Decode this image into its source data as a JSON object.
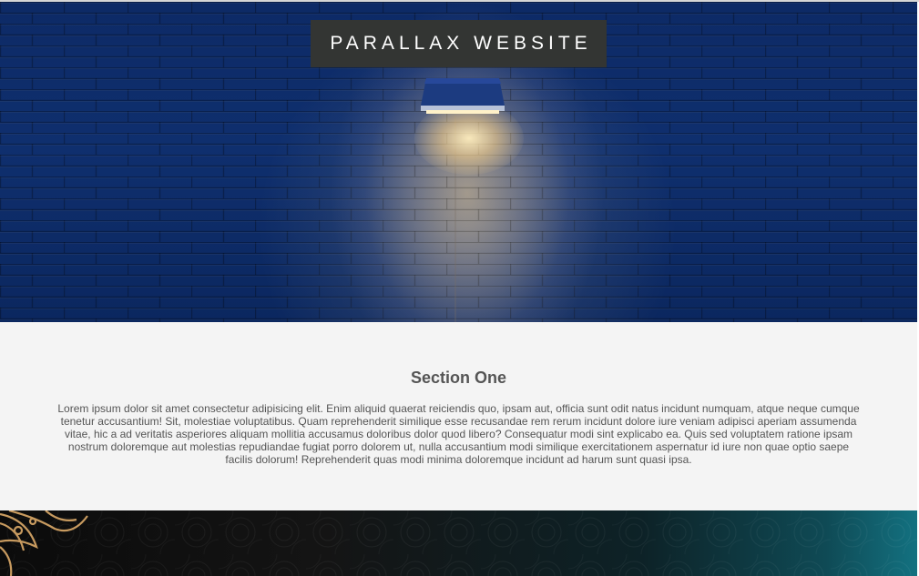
{
  "hero": {
    "title": "PARALLAX WEBSITE",
    "background": "brick-wall-with-lamp"
  },
  "section_one": {
    "title": "Section One",
    "body": "Lorem ipsum dolor sit amet consectetur adipisicing elit. Enim aliquid quaerat reiciendis quo, ipsam aut, officia sunt odit natus incidunt numquam, atque neque cumque tenetur accusantium! Sit, molestiae voluptatibus. Quam reprehenderit similique esse recusandae rem rerum incidunt dolore iure veniam adipisci aperiam assumenda vitae, hic a ad veritatis asperiores aliquam mollitia accusamus doloribus dolor quod libero? Consequatur modi sint explicabo ea. Quis sed voluptatem ratione ipsam nostrum doloremque aut molestias repudiandae fugiat porro dolorem ut, nulla accusantium modi similique exercitationem aspernatur id iure non quae optio saepe facilis dolorum! Reprehenderit quas modi minima doloremque incidunt ad harum sunt quasi ipsa."
  },
  "bottom_band": {
    "background": "dark-mandala-pattern"
  },
  "colors": {
    "hero_blue": "#0f2f6e",
    "title_box": "#333533",
    "section_bg": "#f4f4f4",
    "text_gray": "#555555",
    "band_teal": "#137180",
    "lamp_light": "#ffe8b0"
  }
}
